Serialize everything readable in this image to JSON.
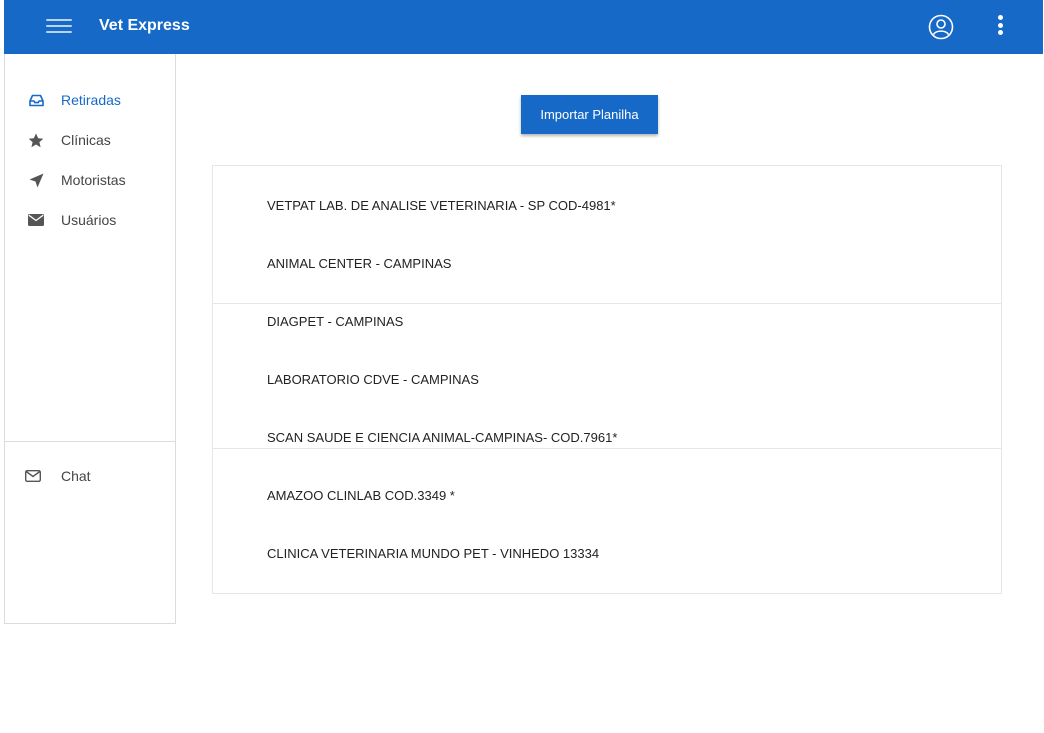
{
  "header": {
    "title": "Vet Express"
  },
  "sidebar": {
    "items": [
      {
        "label": "Retiradas",
        "icon": "inbox-icon"
      },
      {
        "label": "Clínicas",
        "icon": "star-icon"
      },
      {
        "label": "Motoristas",
        "icon": "paper-plane-icon"
      },
      {
        "label": "Usuários",
        "icon": "envelope-icon"
      }
    ],
    "chat": {
      "label": "Chat",
      "icon": "envelope-outline-icon"
    }
  },
  "main": {
    "import_label": "Importar Planilha",
    "clinics": [
      "VETPAT LAB. DE ANALISE VETERINARIA - SP  COD-4981*",
      "ANIMAL CENTER - CAMPINAS",
      "DIAGPET - CAMPINAS",
      "LABORATORIO CDVE - CAMPINAS",
      "SCAN SAUDE E CIENCIA ANIMAL-CAMPINAS- COD.7961*",
      "AMAZOO CLINLAB COD.3349 *",
      "CLINICA VETERINARIA MUNDO PET - VINHEDO 13334"
    ]
  },
  "colors": {
    "primary": "#1769c8",
    "border": "#dcdcdc"
  }
}
